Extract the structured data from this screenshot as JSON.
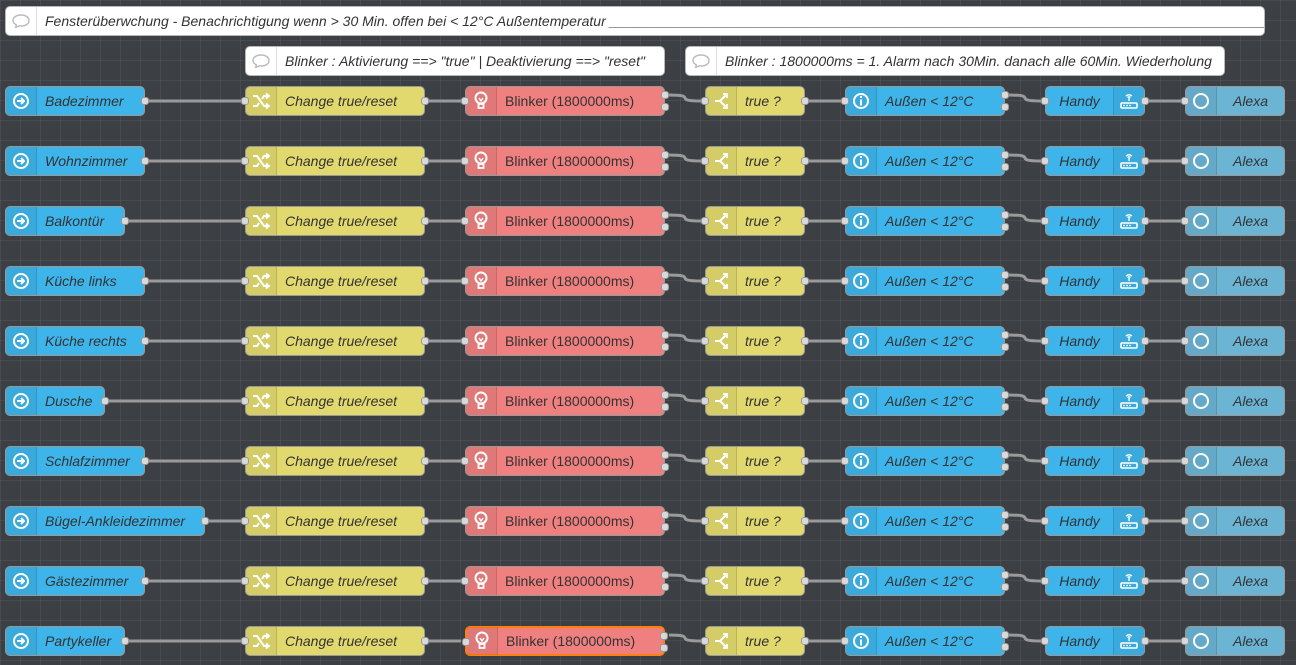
{
  "comments": {
    "main": "Fensterüberwchung - Benachrichtigung wenn > 30 Min. offen bei < 12°C Außentemperatur _______________________________________________________________________________________",
    "blinker_activation": "Blinker : Aktivierung ==> \"true\" | Deaktivierung ==> \"reset\"",
    "blinker_timing": "Blinker : 1800000ms = 1. Alarm nach 30Min. danach alle 60Min. Wiederholung"
  },
  "flow_labels": {
    "change": "Change true/reset",
    "blinker": "Blinker (1800000ms)",
    "switch": "true ?",
    "temp": "Außen < 12°C",
    "handy": "Handy",
    "alexa": "Alexa"
  },
  "rows": [
    {
      "room": "Badezimmer"
    },
    {
      "room": "Wohnzimmer"
    },
    {
      "room": "Balkontür"
    },
    {
      "room": "Küche links"
    },
    {
      "room": "Küche rechts"
    },
    {
      "room": "Dusche"
    },
    {
      "room": "Schlafzimmer"
    },
    {
      "room": "Bügel-Ankleidezimmer"
    },
    {
      "room": "Gästezimmer"
    },
    {
      "room": "Partykeller"
    }
  ],
  "icons": {
    "comment": "speech-bubble-icon",
    "inject": "arrow-right-circle-icon",
    "change": "shuffle-icon",
    "blinker": "light-bulb-icon",
    "switch": "switch-fork-icon",
    "temp": "info-icon",
    "handy": "router-icon",
    "alexa": "ring-icon"
  },
  "colors": {
    "canvas": "#3c3f44",
    "inject": "#3eb5ea",
    "change": "#e2d96e",
    "blinker": "#f08080",
    "selected_outline": "#ff7f0e",
    "alexa": "#6bb4d4"
  }
}
